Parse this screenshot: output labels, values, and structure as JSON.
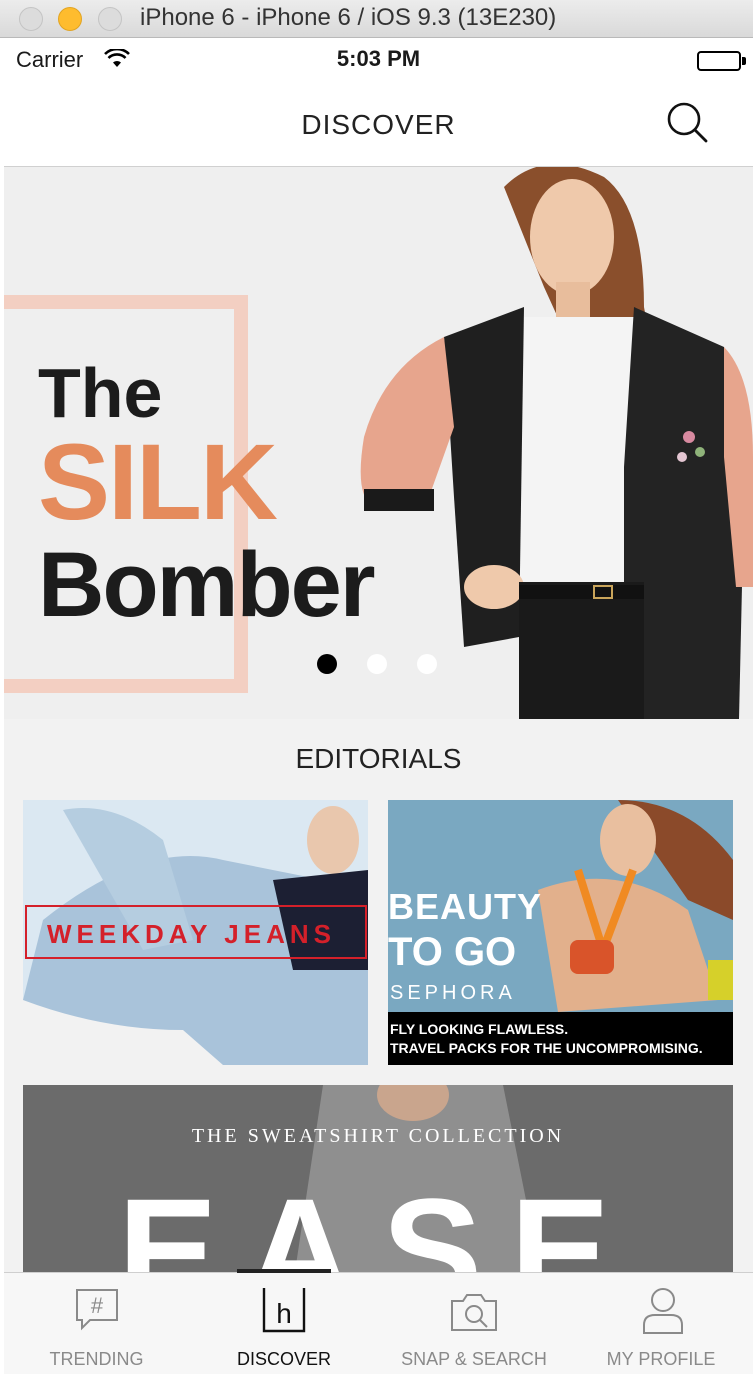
{
  "window": {
    "title": "iPhone 6 - iPhone 6 / iOS 9.3 (13E230)"
  },
  "status_bar": {
    "carrier": "Carrier",
    "time": "5:03 PM"
  },
  "nav": {
    "title": "DISCOVER"
  },
  "hero": {
    "line1": "The",
    "line2": "SILK",
    "line3": "Bomber",
    "page_count": 3,
    "active_page": 1
  },
  "editorials": {
    "title": "EDITORIALS",
    "cards": [
      {
        "headline": "WEEKDAY JEANS"
      },
      {
        "headline_line1": "BEAUTY",
        "headline_line2": "TO GO",
        "brand": "SEPHORA",
        "caption_line1": "FLY LOOKING FLAWLESS.",
        "caption_line2": "TRAVEL PACKS FOR THE UNCOMPROMISING."
      },
      {
        "subtitle": "THE SWEATSHIRT COLLECTION",
        "headline": "EASE"
      }
    ]
  },
  "tab_bar": {
    "tabs": [
      {
        "label": "TRENDING",
        "icon": "hashtag-chat-icon",
        "active": false
      },
      {
        "label": "DISCOVER",
        "icon": "h-logo-icon",
        "active": true
      },
      {
        "label": "SNAP & SEARCH",
        "icon": "camera-search-icon",
        "active": false
      },
      {
        "label": "MY PROFILE",
        "icon": "person-icon",
        "active": false
      }
    ]
  },
  "colors": {
    "accent_orange": "#e58b5c",
    "frame_peach": "#f3cfc2",
    "weekday_red": "#d4202a",
    "traffic_yellow": "#febc2e"
  }
}
